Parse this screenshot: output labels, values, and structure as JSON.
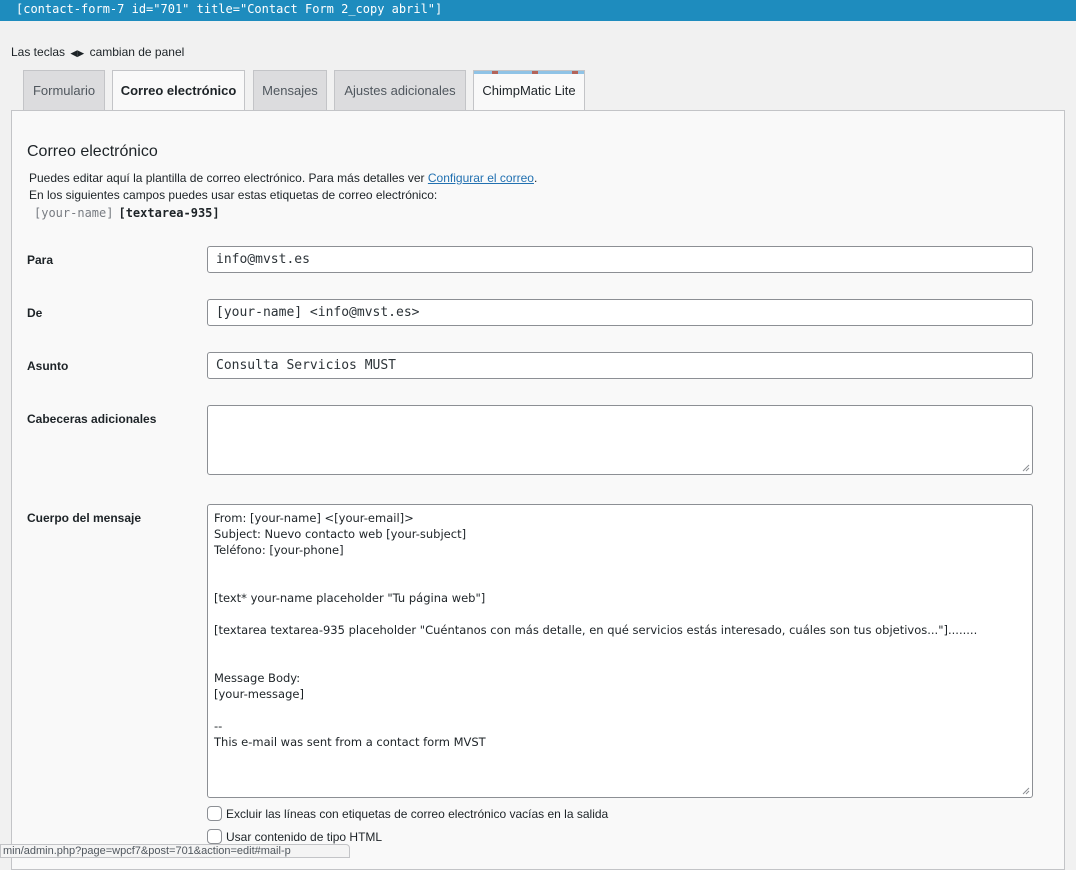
{
  "shortcode": "[contact-form-7 id=\"701\" title=\"Contact Form 2_copy abril\"]",
  "panel_hint": {
    "before": "Las teclas",
    "after": "cambian de panel"
  },
  "tabs": [
    {
      "label": "Formulario",
      "active": false
    },
    {
      "label": "Correo electrónico",
      "active": true
    },
    {
      "label": "Mensajes",
      "active": false
    },
    {
      "label": "Ajustes adicionales",
      "active": false
    },
    {
      "label": "ChimpMatic Lite",
      "active": false
    }
  ],
  "mail": {
    "title": "Correo electrónico",
    "desc1_prefix": "Puedes editar aquí la plantilla de correo electrónico. Para más detalles ver ",
    "desc1_link": "Configurar el correo",
    "desc1_suffix": ".",
    "desc2": "En los siguientes campos puedes usar estas etiquetas de correo electrónico:",
    "tags": [
      "[your-name]",
      "[textarea-935]"
    ],
    "fields": {
      "to": {
        "label": "Para",
        "value": "info@mvst.es"
      },
      "from": {
        "label": "De",
        "value": "[your-name] <info@mvst.es>"
      },
      "subject": {
        "label": "Asunto",
        "value": "Consulta Servicios MUST"
      },
      "headers": {
        "label": "Cabeceras adicionales",
        "value": ""
      },
      "body": {
        "label": "Cuerpo del mensaje",
        "lines": [
          "From: [your-name] <[your-email]>",
          "Subject: Nuevo contacto web [your-subject]",
          "Teléfono: [your-phone]",
          "",
          "",
          "[text* your-name placeholder \"Tu página web\"]",
          "",
          "[textarea textarea-935 placeholder \"Cuéntanos con más detalle, en qué servicios estás interesado, cuáles son tus objetivos...\"]........",
          "",
          "",
          "Message Body:",
          "[your-message]",
          "",
          "--",
          "This e-mail was sent from a contact form MVST"
        ]
      }
    },
    "options": {
      "exclude_blank": {
        "label": "Excluir las líneas con etiquetas de correo electrónico vacías en la salida",
        "checked": false
      },
      "use_html": {
        "label": "Usar contenido de tipo HTML",
        "checked": false
      }
    }
  },
  "status_url": "min/admin.php?page=wpcf7&post=701&action=edit#mail-p"
}
